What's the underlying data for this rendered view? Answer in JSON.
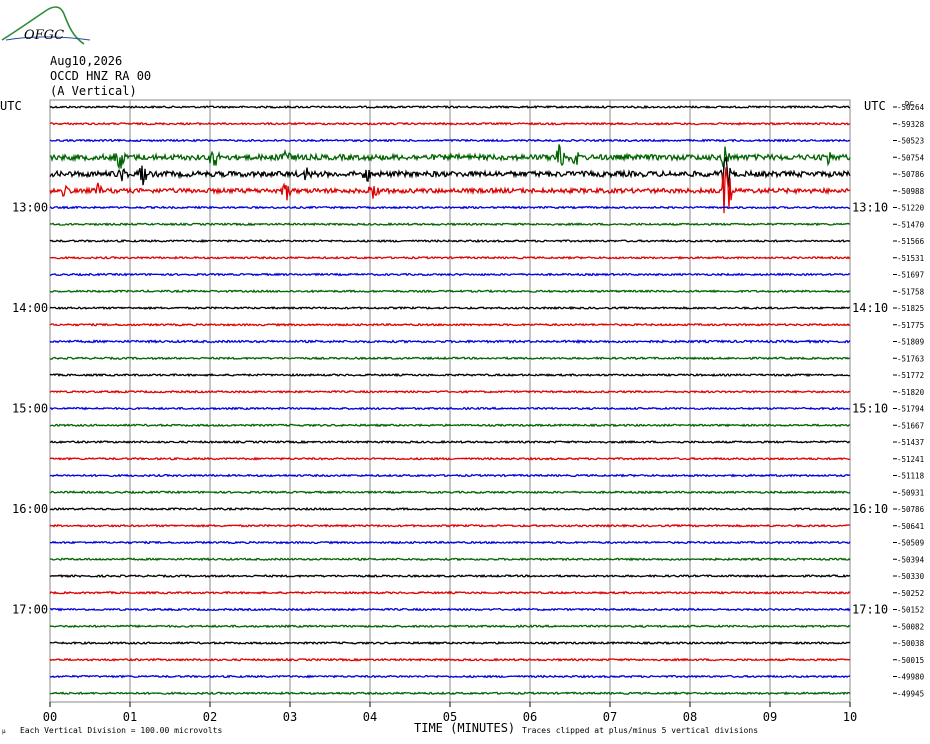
{
  "logo": {
    "text": "OFGC",
    "color": "#2b4a9c",
    "mountain_color": "#2e8b3a"
  },
  "header": {
    "date": "Aug10,2026",
    "station": "OCCD HNZ RA 00",
    "component": "(A Vertical)",
    "left_tz": "UTC",
    "right_tz": "UTC",
    "dc_label": "DC"
  },
  "footer": {
    "xlabel": "TIME (MINUTES)",
    "scale_note": "Each Vertical Division =  100.00 microvolts",
    "clip_note": "Traces clipped at plus/minus 5 vertical divisions",
    "small_mark": "μ"
  },
  "chart_data": {
    "type": "line",
    "title": "",
    "xlabel": "TIME (MINUTES)",
    "xlim": [
      0,
      10
    ],
    "x_ticks": [
      "00",
      "01",
      "02",
      "03",
      "04",
      "05",
      "06",
      "07",
      "08",
      "09",
      "10"
    ],
    "grid": true,
    "minutes_per_row": 10,
    "left_hour_labels": [
      {
        "row": 6,
        "label": "13:00"
      },
      {
        "row": 12,
        "label": "14:00"
      },
      {
        "row": 18,
        "label": "15:00"
      },
      {
        "row": 24,
        "label": "16:00"
      },
      {
        "row": 30,
        "label": "17:00"
      }
    ],
    "right_hour_labels": [
      {
        "row": 6,
        "label": "13:10"
      },
      {
        "row": 12,
        "label": "14:10"
      },
      {
        "row": 18,
        "label": "15:10"
      },
      {
        "row": 24,
        "label": "16:10"
      },
      {
        "row": 30,
        "label": "17:10"
      }
    ],
    "row_colors": [
      "#000000",
      "#dd0000",
      "#0000dd",
      "#006400"
    ],
    "dc_offsets": [
      "-50264",
      "-59328",
      "-50523",
      "-50754",
      "-50786",
      "-50988",
      "-51220",
      "-51470",
      "-51566",
      "-51531",
      "-51697",
      "-51758",
      "-51825",
      "-51775",
      "-51809",
      "-51763",
      "-51772",
      "-51820",
      "-51794",
      "-51667",
      "-51437",
      "-51241",
      "-51118",
      "-50931",
      "-50786",
      "-50641",
      "-50509",
      "-50394",
      "-50330",
      "-50252",
      "-50152",
      "-50082",
      "-50038",
      "-50015",
      "-49980",
      "-49945"
    ],
    "row_activity": [
      1,
      1,
      1,
      3,
      3,
      2.5,
      1,
      1,
      1,
      1,
      1,
      1,
      1,
      1,
      1.2,
      1,
      1,
      1,
      1,
      1,
      1,
      1,
      1,
      1,
      1,
      1,
      1,
      1,
      1,
      1,
      1,
      1,
      1,
      1,
      1,
      1
    ],
    "events": [
      {
        "row": 3,
        "minute": 0.87,
        "amplitude": 1.0
      },
      {
        "row": 3,
        "minute": 2.05,
        "amplitude": 0.6
      },
      {
        "row": 3,
        "minute": 2.95,
        "amplitude": 0.7
      },
      {
        "row": 3,
        "minute": 6.37,
        "amplitude": 0.9
      },
      {
        "row": 3,
        "minute": 6.55,
        "amplitude": 0.8
      },
      {
        "row": 3,
        "minute": 8.43,
        "amplitude": 0.9
      },
      {
        "row": 3,
        "minute": 9.75,
        "amplitude": 0.6
      },
      {
        "row": 4,
        "minute": 0.9,
        "amplitude": 0.5
      },
      {
        "row": 4,
        "minute": 1.15,
        "amplitude": 0.8
      },
      {
        "row": 4,
        "minute": 3.2,
        "amplitude": 0.4
      },
      {
        "row": 4,
        "minute": 3.95,
        "amplitude": 0.5
      },
      {
        "row": 4,
        "minute": 8.45,
        "amplitude": 1.4
      },
      {
        "row": 5,
        "minute": 0.2,
        "amplitude": 0.4
      },
      {
        "row": 5,
        "minute": 0.6,
        "amplitude": 0.5
      },
      {
        "row": 5,
        "minute": 2.95,
        "amplitude": 0.7
      },
      {
        "row": 5,
        "minute": 4.05,
        "amplitude": 0.6
      },
      {
        "row": 5,
        "minute": 8.45,
        "amplitude": 2.4
      }
    ]
  }
}
